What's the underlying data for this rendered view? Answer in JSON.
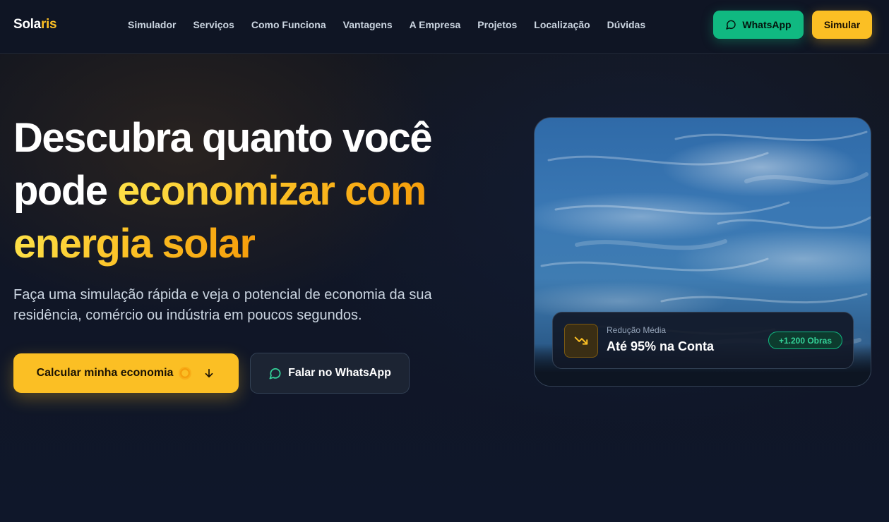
{
  "brand": {
    "name_part1": "Sola",
    "name_part2": "ris"
  },
  "nav": {
    "items": [
      {
        "label": "Simulador"
      },
      {
        "label": "Serviços"
      },
      {
        "label": "Como Funciona"
      },
      {
        "label": "Vantagens"
      },
      {
        "label": "A Empresa"
      },
      {
        "label": "Projetos"
      },
      {
        "label": "Localização"
      },
      {
        "label": "Dúvidas"
      }
    ]
  },
  "header_actions": {
    "whatsapp_label": "WhatsApp",
    "simulate_label": "Simular"
  },
  "hero": {
    "title_line1": "Descubra quanto você",
    "title_line2_plain": "pode ",
    "title_line2_highlight": "economizar com",
    "title_line3_highlight": "energia solar",
    "subtitle": "Faça uma simulação rápida e veja o potencial de economia da sua residência, comércio ou indústria em poucos segundos.",
    "primary_cta": "Calcular minha economia",
    "secondary_cta": "Falar no WhatsApp"
  },
  "stat_card": {
    "label": "Redução Média",
    "value": "Até 95% na Conta",
    "badge": "+1.200 Obras",
    "icon": "trending-down-icon"
  },
  "colors": {
    "accent": "#fbbf24",
    "whatsapp": "#10b981",
    "background": "#0f172a"
  }
}
